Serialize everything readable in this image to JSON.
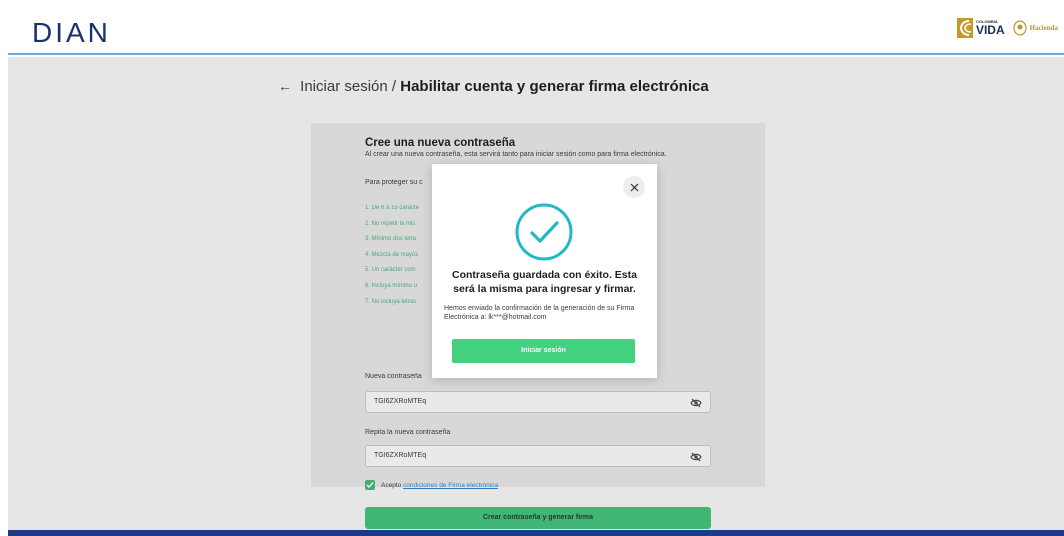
{
  "header": {
    "logo_text": "DIAN",
    "colombia_small": "COLOMBIA",
    "colombia_vida": "VIDA",
    "hacienda": "Hacienda"
  },
  "breadcrumb": {
    "back_icon": "arrow-left-icon",
    "link": "Iniciar sesión",
    "separator": "/",
    "current": "Habilitar cuenta y generar firma electrónica"
  },
  "form": {
    "title": "Cree una nueva contraseña",
    "subtitle": "Al crear una nueva contraseña, esta servirá tanto para iniciar sesión como para firma electrónica.",
    "protect_text": "Para proteger su c",
    "requirements": [
      "1. De 6 a 15 caracte",
      "2. No repetir la mis",
      "3. Mínimo dos letra",
      "4. Mezcla de mayús",
      "5. Un carácter com",
      "6. Incluya mínimo u",
      "7. No incluya letras"
    ],
    "new_password_label": "Nueva contraseña",
    "new_password_value": "TGI6ZXRoMTEq",
    "repeat_label": "Repita la nueva contraseña",
    "repeat_value": "TGI6ZXRoMTEq",
    "accept_text": "Acepto",
    "accept_link": "condiciones de Firma electrónica",
    "submit_label": "Crear contraseña y generar firma"
  },
  "modal": {
    "title": "Contraseña guardada con éxito. Esta será la misma para ingresar y firmar.",
    "message": "Hemos enviado la confirmación de la generación de su Firma Electrónica a: lk***@hotmail.com",
    "button_label": "Iniciar sesión",
    "close_icon": "close-icon",
    "success_icon": "check-circle-icon"
  },
  "colors": {
    "accent_green": "#41d17f",
    "brand_blue": "#1b3a8a",
    "success_teal": "#22b8c8"
  }
}
